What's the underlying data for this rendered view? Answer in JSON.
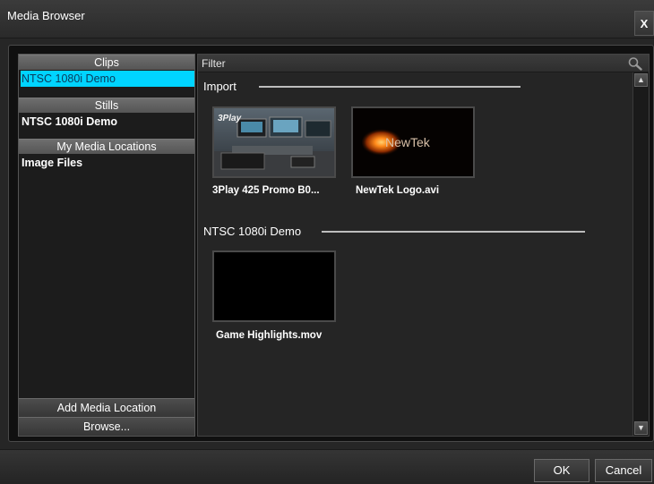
{
  "window": {
    "title": "Media Browser",
    "close_label": "X"
  },
  "sidebar": {
    "clips_header": "Clips",
    "clips_items": [
      "NTSC 1080i Demo"
    ],
    "stills_header": "Stills",
    "stills_items": [
      "NTSC 1080i Demo"
    ],
    "locations_header": "My Media Locations",
    "locations_items": [
      "Image Files"
    ],
    "add_location_label": "Add Media Location",
    "browse_label": "Browse..."
  },
  "content": {
    "filter_label": "Filter",
    "groups": [
      {
        "name": "Import",
        "items": [
          "3Play 425 Promo B0...",
          "NewTek Logo.avi"
        ]
      },
      {
        "name": "NTSC 1080i Demo",
        "items": [
          "Game Highlights.mov"
        ]
      }
    ],
    "thumb_text": {
      "threeplay_logo": "3Play",
      "newtek_logo": "NewTek"
    }
  },
  "footer": {
    "ok_label": "OK",
    "cancel_label": "Cancel"
  },
  "colors": {
    "selection": "#00d4ff",
    "background": "#262626"
  },
  "icons": {
    "filter_search": "search-icon",
    "scroll_up": "scroll-up-arrow-icon",
    "scroll_down": "scroll-down-arrow-icon"
  }
}
